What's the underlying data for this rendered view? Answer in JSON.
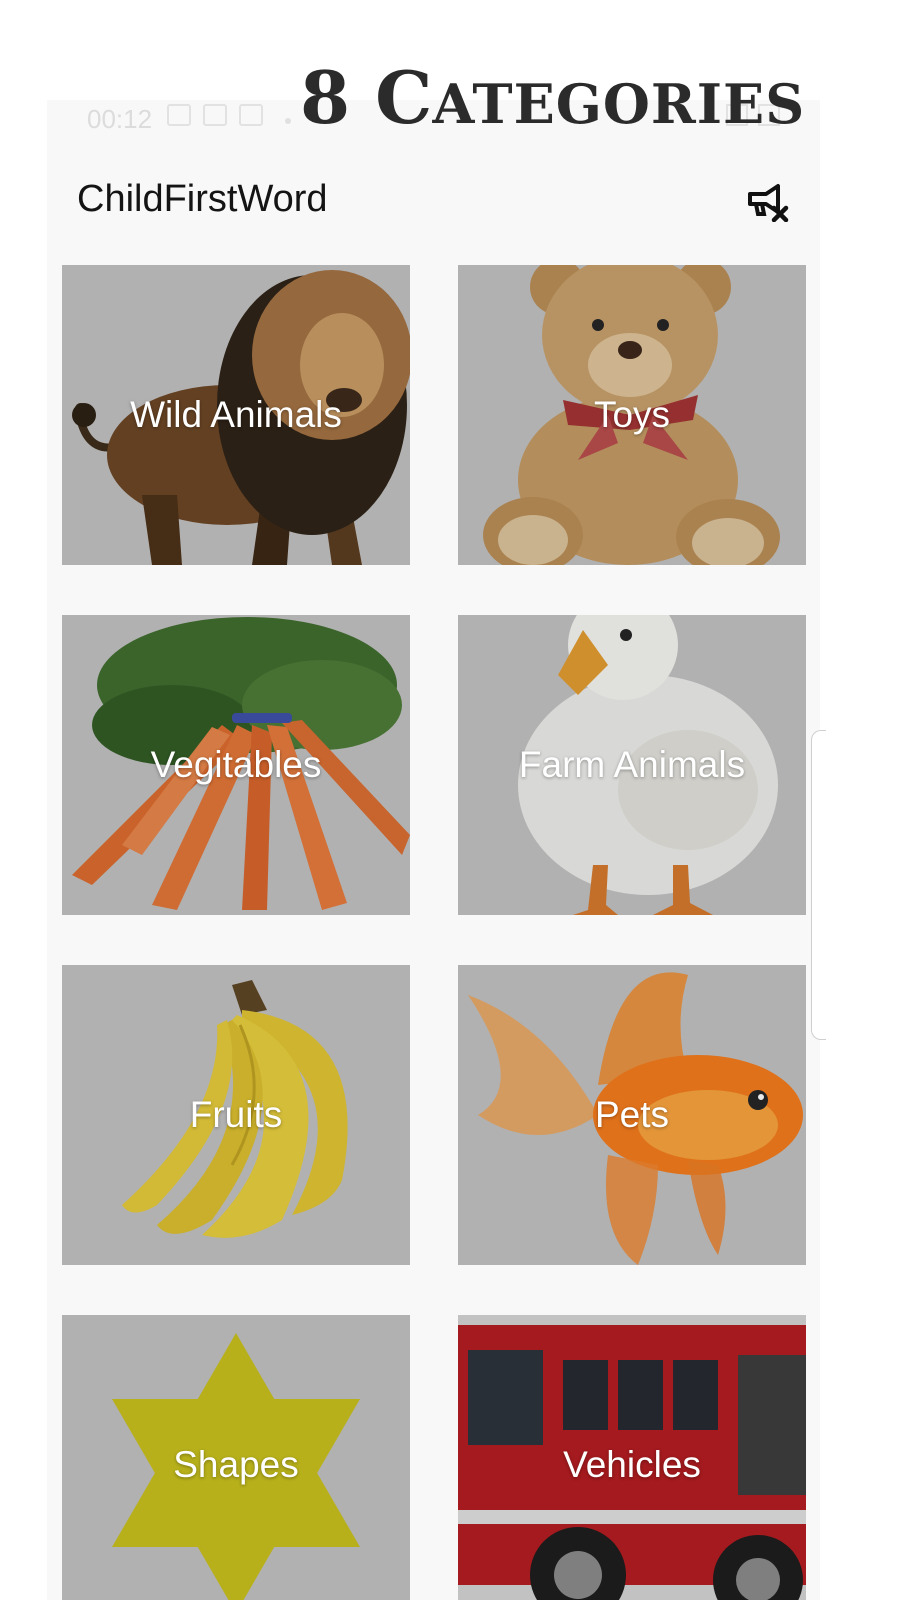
{
  "banner": {
    "title_first": "8 C",
    "title_rest": "ATEGORIES"
  },
  "status_bar": {
    "time": "00:12"
  },
  "app_bar": {
    "title": "ChildFirstWord",
    "ads_icon": "megaphone-off-icon"
  },
  "categories": [
    {
      "label": "Wild Animals",
      "image": "lion"
    },
    {
      "label": "Toys",
      "image": "teddy-bear"
    },
    {
      "label": "Vegitables",
      "image": "carrots"
    },
    {
      "label": "Farm Animals",
      "image": "duck"
    },
    {
      "label": "Fruits",
      "image": "bananas"
    },
    {
      "label": "Pets",
      "image": "goldfish"
    },
    {
      "label": "Shapes",
      "image": "star-of-david"
    },
    {
      "label": "Vehicles",
      "image": "fire-truck"
    }
  ],
  "colors": {
    "tile_bg": "#c1c1c1",
    "shape_yellow": "#c8c01a",
    "truck_red": "#b3191d"
  }
}
